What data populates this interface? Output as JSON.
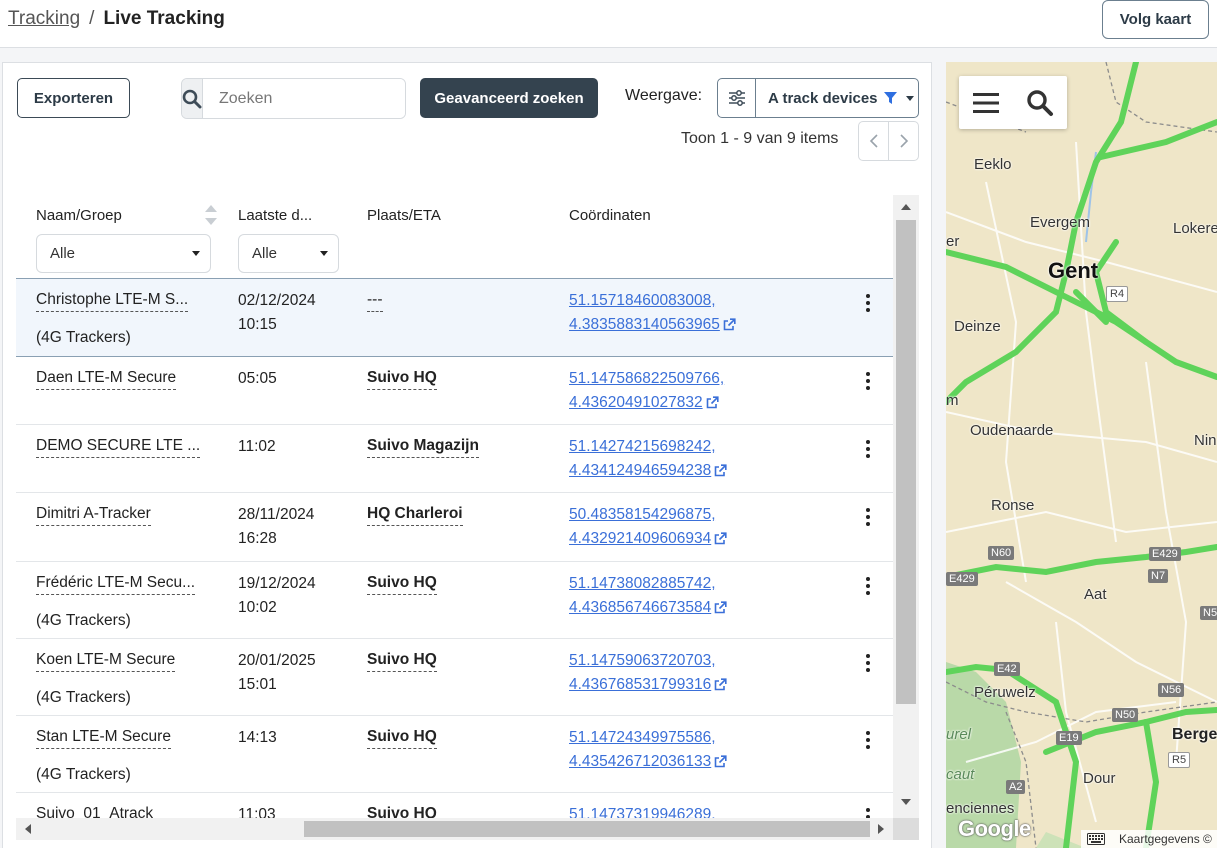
{
  "breadcrumb": {
    "parent": "Tracking",
    "separator": "/",
    "current": "Live Tracking"
  },
  "header": {
    "follow_map_label": "Volg kaart"
  },
  "toolbar": {
    "export_label": "Exporteren",
    "search_placeholder": "Zoeken",
    "advanced_search_label": "Geavanceerd zoeken",
    "view_label": "Weergave:",
    "view_selected": "A track devices",
    "pager_text": "Toon 1 - 9 van 9 items"
  },
  "table": {
    "columns": {
      "name": "Naam/Groep",
      "last": "Laatste d...",
      "place": "Plaats/ETA",
      "coords": "Coördinaten"
    },
    "filters": {
      "name": "Alle",
      "last": "Alle"
    },
    "rows": [
      {
        "name": "Christophe LTE-M S...",
        "group": "(4G Trackers)",
        "date": "02/12/2024",
        "time": "10:15",
        "place": "---",
        "lat": "51.15718460083008,",
        "lon": "4.3835883140563965"
      },
      {
        "name": "Daen LTE-M Secure",
        "group": "",
        "date": "05:05",
        "time": "",
        "place": "Suivo HQ",
        "lat": "51.147586822509766,",
        "lon": "4.43620491027832"
      },
      {
        "name": "DEMO SECURE LTE ...",
        "group": "",
        "date": "11:02",
        "time": "",
        "place": "Suivo Magazijn",
        "lat": "51.14274215698242,",
        "lon": "4.434124946594238"
      },
      {
        "name": "Dimitri A-Tracker",
        "group": "",
        "date": "28/11/2024",
        "time": "16:28",
        "place": "HQ Charleroi",
        "lat": "50.48358154296875,",
        "lon": "4.432921409606934"
      },
      {
        "name": "Frédéric LTE-M Secu...",
        "group": "(4G Trackers)",
        "date": "19/12/2024",
        "time": "10:02",
        "place": "Suivo HQ",
        "lat": "51.14738082885742,",
        "lon": "4.436856746673584"
      },
      {
        "name": "Koen LTE-M Secure",
        "group": "(4G Trackers)",
        "date": "20/01/2025",
        "time": "15:01",
        "place": "Suivo HQ",
        "lat": "51.14759063720703,",
        "lon": "4.436768531799316"
      },
      {
        "name": "Stan LTE-M Secure",
        "group": "(4G Trackers)",
        "date": "14:13",
        "time": "",
        "place": "Suivo HQ",
        "lat": "51.14724349975586,",
        "lon": "4.435426712036133"
      },
      {
        "name": "Suivo_01_Atrack",
        "group": "",
        "date": "11:03",
        "time": "",
        "place": "Suivo HQ",
        "lat": "51.14737319946289,",
        "lon": ""
      }
    ]
  },
  "map": {
    "labels": {
      "eeklo": "Eeklo",
      "evergem": "Evergem",
      "lokeren": "Lokere",
      "gent": "Gent",
      "deinze": "Deinze",
      "oudenaarde": "Oudenaarde",
      "ninove": "Nin",
      "ronse": "Ronse",
      "aat": "Aat",
      "peruwelz": "Péruwelz",
      "bergen": "Bergen",
      "dour": "Dour",
      "valenciennes": "enciennes",
      "west1": "er",
      "west2": "m",
      "park1": "urel",
      "park2": "caut"
    },
    "roads": {
      "r4": "R4",
      "n60": "N60",
      "e429a": "E429",
      "e429b": "E429",
      "n7": "N7",
      "n5": "N5",
      "e42": "E42",
      "n56": "N56",
      "n50": "N50",
      "e19": "E19",
      "r5": "R5",
      "a2": "A2"
    },
    "google": "Google",
    "attribution": "Kaartgegevens ©"
  },
  "colors": {
    "accent_dark": "#34434f",
    "link": "#3a6fd8",
    "road_green": "#5fd35a",
    "map_bg": "#efe6c8"
  }
}
